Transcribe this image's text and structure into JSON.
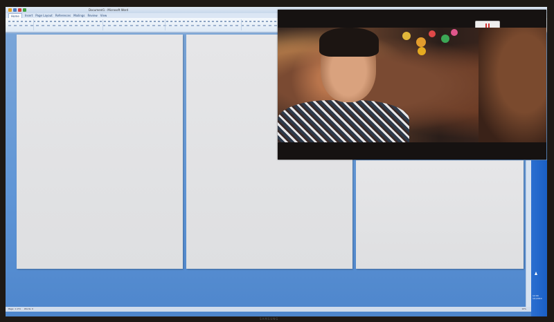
{
  "app": {
    "title": "Document1 - Microsoft Word",
    "tabs": [
      "Home",
      "Insert",
      "Page Layout",
      "References",
      "Mailings",
      "Review",
      "View"
    ],
    "active_tab": "Home"
  },
  "ribbon": {
    "groups": [
      "Clipboard",
      "Font",
      "Paragraph",
      "Styles",
      "Editing"
    ]
  },
  "document": {
    "page_count_visible": 6
  },
  "statusbar": {
    "page": "Page: 1 of 6",
    "words": "Words: 0",
    "zoom": "10%"
  },
  "video": {
    "pause_label": "Pause"
  },
  "taskbar": {
    "time": "12:00",
    "date": "1/1/2010"
  },
  "monitor": {
    "brand": "SAMSUNG"
  },
  "colors": {
    "desktop": "#5f95d6",
    "ribbon": "#dde8f5",
    "taskbar": "#1a5fc6",
    "pause_icon": "#d03030"
  }
}
